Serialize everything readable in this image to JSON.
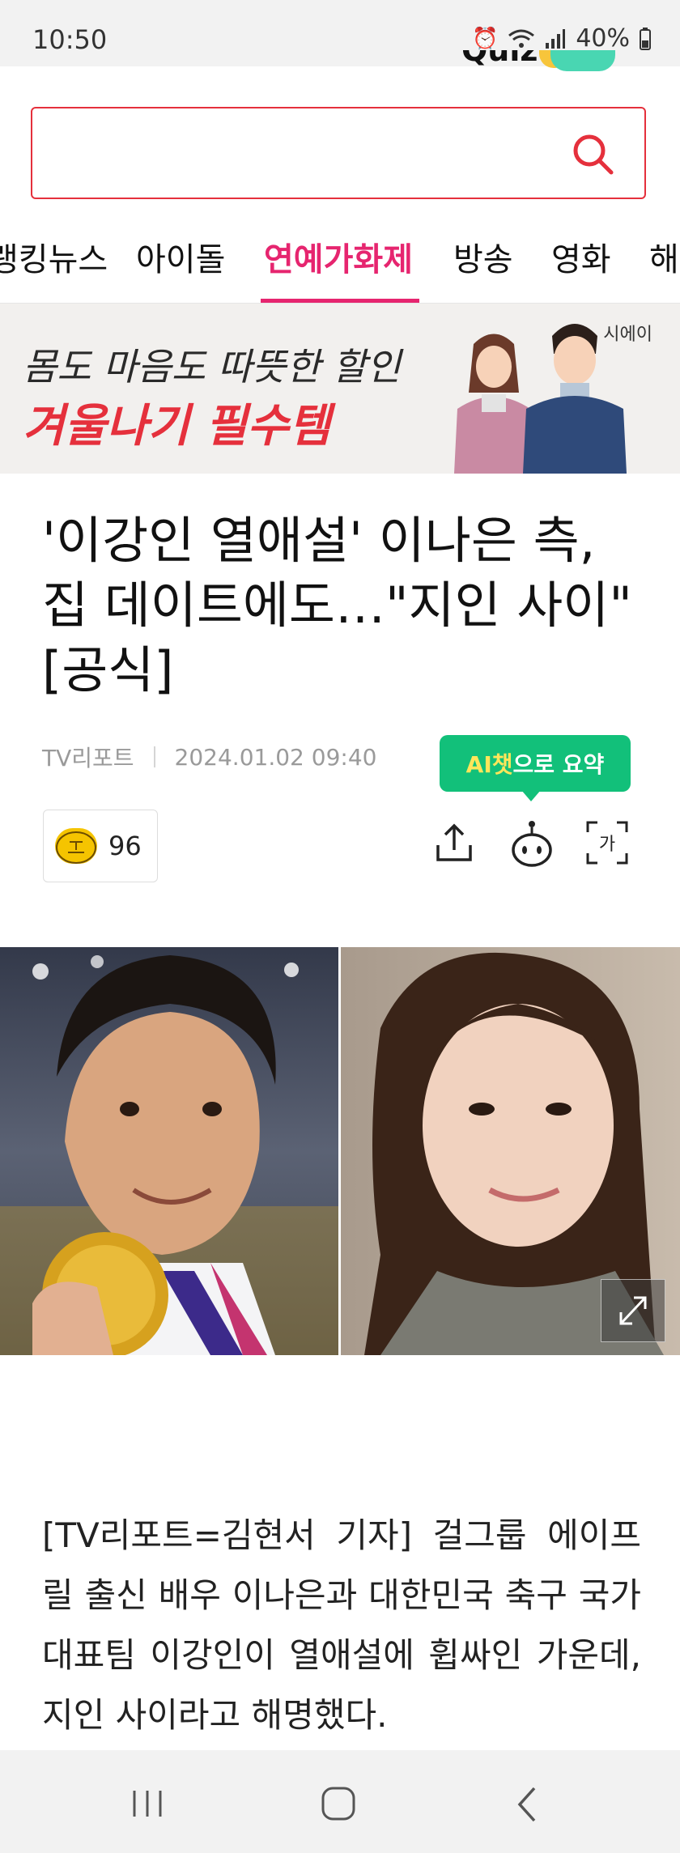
{
  "status_bar": {
    "time": "10:50",
    "battery": "40%",
    "icons": [
      "alarm-icon",
      "wifi-icon",
      "signal-icon",
      "battery-icon"
    ]
  },
  "logo": {
    "text": "Quiz"
  },
  "search": {
    "value": "",
    "placeholder": ""
  },
  "nav": {
    "items": [
      {
        "label": "랭킹뉴스"
      },
      {
        "label": "아이돌"
      },
      {
        "label": "연예가화제",
        "active": true
      },
      {
        "label": "방송"
      },
      {
        "label": "영화"
      },
      {
        "label": "해"
      }
    ]
  },
  "banner": {
    "line1": "몸도 마음도 따뜻한 할인",
    "line2": "겨울나기 필수템",
    "brand": "시에이"
  },
  "article": {
    "title": "'이강인 열애설' 이나은 측, 집 데이트에도…\"지인 사이\" [공식]",
    "source": "TV리포트",
    "date": "2024.01.02 09:40",
    "ai_button_prefix": "AI챗",
    "ai_button_suffix": "으로 요약",
    "reaction_count": "96",
    "body": "[TV리포트=김현서 기자] 걸그룹 에이프릴 출신 배우 이나은과 대한민국 축구 국가대표팀 이강인이 열애설에 휩싸인 가운데, 지인 사이라고 해명했다."
  },
  "colors": {
    "accent_pink": "#e6256f",
    "search_border": "#e5303c",
    "ai_green": "#12c07a",
    "banner_red": "#e5303c"
  }
}
